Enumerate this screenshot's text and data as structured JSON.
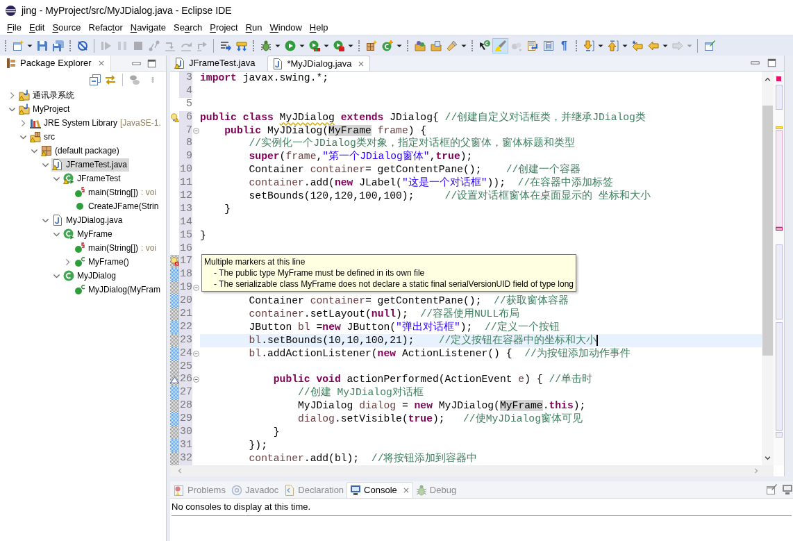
{
  "window": {
    "title": "jing - MyProject/src/MyJDialog.java - Eclipse IDE"
  },
  "menu": [
    {
      "key": "F",
      "after": "ile"
    },
    {
      "key": "E",
      "after": "dit"
    },
    {
      "key": "S",
      "after": "ource"
    },
    {
      "before": "Refac",
      "key": "t",
      "after": "or"
    },
    {
      "key": "N",
      "after": "avigate"
    },
    {
      "before": "Se",
      "key": "a",
      "after": "rch"
    },
    {
      "key": "P",
      "after": "roject"
    },
    {
      "key": "R",
      "after": "un"
    },
    {
      "key": "W",
      "after": "indow"
    },
    {
      "key": "H",
      "after": "elp"
    }
  ],
  "toolbar": [
    {
      "kind": "grip"
    },
    {
      "kind": "new-wizard",
      "disabled": false,
      "pressed": false,
      "menu": true
    },
    {
      "kind": "save",
      "disabled": false,
      "pressed": false,
      "menu": false
    },
    {
      "kind": "save-all",
      "disabled": false,
      "pressed": false,
      "menu": false
    },
    {
      "kind": "grip"
    },
    {
      "kind": "skip-breakpoints",
      "disabled": false,
      "pressed": false,
      "menu": false
    },
    {
      "kind": "separator"
    },
    {
      "kind": "resume",
      "disabled": true,
      "pressed": false,
      "menu": false
    },
    {
      "kind": "suspend",
      "disabled": true,
      "pressed": false,
      "menu": false
    },
    {
      "kind": "terminate",
      "disabled": true,
      "pressed": false,
      "menu": false
    },
    {
      "kind": "disconnect",
      "disabled": true,
      "pressed": false,
      "menu": false
    },
    {
      "kind": "step-into",
      "disabled": true,
      "pressed": false,
      "menu": false
    },
    {
      "kind": "step-over",
      "disabled": true,
      "pressed": false,
      "menu": false
    },
    {
      "kind": "step-return",
      "disabled": true,
      "pressed": false,
      "menu": false
    },
    {
      "kind": "separator"
    },
    {
      "kind": "step-filters",
      "disabled": false,
      "pressed": false,
      "menu": false
    },
    {
      "kind": "fork-arrows",
      "disabled": false,
      "pressed": false,
      "menu": false
    },
    {
      "kind": "grip"
    },
    {
      "kind": "debug",
      "disabled": false,
      "pressed": false,
      "menu": true
    },
    {
      "kind": "run",
      "disabled": false,
      "pressed": false,
      "menu": true
    },
    {
      "kind": "coverage",
      "disabled": false,
      "pressed": false,
      "menu": true
    },
    {
      "kind": "external-tools",
      "disabled": false,
      "pressed": false,
      "menu": true
    },
    {
      "kind": "grip"
    },
    {
      "kind": "new-package",
      "disabled": false,
      "pressed": false,
      "menu": false
    },
    {
      "kind": "new-class",
      "disabled": false,
      "pressed": false,
      "menu": true
    },
    {
      "kind": "grip"
    },
    {
      "kind": "open-type",
      "disabled": false,
      "pressed": false,
      "menu": false
    },
    {
      "kind": "open-task",
      "disabled": false,
      "pressed": false,
      "menu": false
    },
    {
      "kind": "search",
      "disabled": false,
      "pressed": false,
      "menu": true
    },
    {
      "kind": "grip"
    },
    {
      "kind": "breadcrumb",
      "disabled": false,
      "pressed": false,
      "menu": false
    },
    {
      "kind": "mark-occurrences",
      "disabled": false,
      "pressed": true,
      "menu": false
    },
    {
      "kind": "block-selection",
      "disabled": true,
      "pressed": false,
      "menu": false
    },
    {
      "kind": "word-wrap",
      "disabled": false,
      "pressed": false,
      "menu": false
    },
    {
      "kind": "framed-lines",
      "disabled": false,
      "pressed": false,
      "menu": false
    },
    {
      "kind": "whitespace",
      "glyph": "¶",
      "disabled": false,
      "pressed": false,
      "menu": false
    },
    {
      "kind": "grip"
    },
    {
      "kind": "next-annotation",
      "disabled": false,
      "pressed": false,
      "menu": true
    },
    {
      "kind": "prev-annotation",
      "disabled": false,
      "pressed": false,
      "menu": true
    },
    {
      "kind": "last-edit",
      "disabled": false,
      "pressed": false,
      "menu": false
    },
    {
      "kind": "back",
      "disabled": false,
      "pressed": false,
      "menu": true
    },
    {
      "kind": "forward",
      "disabled": true,
      "pressed": false,
      "menu": true
    },
    {
      "kind": "separator"
    },
    {
      "kind": "open-perspective",
      "disabled": false,
      "pressed": false,
      "menu": false
    }
  ],
  "package_explorer": {
    "title": "Package Explorer",
    "tree": [
      {
        "label": "通讯录系统",
        "kind": "project",
        "warning": true,
        "expanded": false,
        "selected": false
      },
      {
        "label": "MyProject",
        "kind": "project",
        "warning": true,
        "expanded": true,
        "selected": false,
        "children": [
          {
            "label": "JRE System Library",
            "detail": "[JavaSE-1.",
            "kind": "library",
            "warning": false,
            "expanded": false,
            "selected": false
          },
          {
            "label": "src",
            "kind": "source-folder",
            "warning": true,
            "expanded": true,
            "selected": false,
            "children": [
              {
                "label": "(default package)",
                "kind": "package",
                "warning": true,
                "expanded": true,
                "selected": false,
                "children": [
                  {
                    "label": "JFrameTest.java",
                    "kind": "java-file",
                    "warning": true,
                    "expanded": true,
                    "selected": true,
                    "children": [
                      {
                        "label": "JFrameTest",
                        "kind": "runnable-class",
                        "warning": true,
                        "expanded": true,
                        "selected": false,
                        "children": [
                          {
                            "label": "main(String[])",
                            "detail": ": voi",
                            "kind": "static-method",
                            "warning": false,
                            "selected": false
                          },
                          {
                            "label": "CreateJFame(Strin",
                            "kind": "method",
                            "warning": false,
                            "selected": false
                          }
                        ]
                      }
                    ]
                  },
                  {
                    "label": "MyJDialog.java",
                    "kind": "java-file",
                    "warning": false,
                    "expanded": true,
                    "selected": false,
                    "children": [
                      {
                        "label": "MyFrame",
                        "kind": "runnable-class",
                        "warning": false,
                        "expanded": true,
                        "selected": false,
                        "children": [
                          {
                            "label": "main(String[])",
                            "detail": ": voi",
                            "kind": "static-method",
                            "warning": false,
                            "selected": false
                          },
                          {
                            "label": "MyFrame()",
                            "kind": "constructor",
                            "warning": false,
                            "expanded": false,
                            "selected": false
                          }
                        ]
                      },
                      {
                        "label": "MyJDialog",
                        "kind": "class",
                        "warning": false,
                        "expanded": true,
                        "selected": false,
                        "children": [
                          {
                            "label": "MyJDialog(MyFram",
                            "kind": "constructor",
                            "warning": false,
                            "selected": false
                          }
                        ]
                      }
                    ]
                  }
                ]
              }
            ]
          }
        ]
      }
    ]
  },
  "editor": {
    "tabs": [
      {
        "label": "JFrameTest.java",
        "warning": true,
        "selected": false
      },
      {
        "label": "*MyJDialog.java",
        "warning": false,
        "selected": true
      }
    ],
    "lines": [
      {
        "number": "3",
        "change": true,
        "range": false,
        "current": false,
        "tokens": [
          {
            "kind": "kw",
            "text": "import"
          },
          {
            "kind": "txt",
            "text": " javax.swing.*;"
          }
        ]
      },
      {
        "number": "4",
        "change": true,
        "range": false,
        "current": false
      },
      {
        "number": "5",
        "change": false,
        "range": false,
        "current": false
      },
      {
        "number": "6",
        "change": true,
        "range": false,
        "current": false,
        "marker": {
          "kind": "warning"
        },
        "tokens": [
          {
            "kind": "kw",
            "text": "public class "
          },
          {
            "kind": "warn",
            "text": "MyJDialog"
          },
          {
            "kind": "kw",
            "text": " extends"
          },
          {
            "kind": "txt",
            "text": " JDialog{ "
          },
          {
            "kind": "com",
            "text": "//创建自定义对话框类，并继承JDialog类"
          }
        ]
      },
      {
        "number": "7",
        "change": true,
        "range": false,
        "current": false,
        "fold": {
          "expanded": true
        },
        "tokens": [
          {
            "kind": "kw",
            "text": "    public"
          },
          {
            "kind": "txt",
            "text": " MyJDialog("
          },
          {
            "kind": "occ",
            "text": "MyFrame"
          },
          {
            "kind": "var",
            "text": " frame"
          },
          {
            "kind": "txt",
            "text": ") {"
          }
        ]
      },
      {
        "number": "8",
        "change": true,
        "range": false,
        "current": false,
        "tokens": [
          {
            "kind": "com",
            "text": "        //实例化一个JDialog类对象，指定对话框的父窗体，窗体标题和类型"
          }
        ]
      },
      {
        "number": "9",
        "change": true,
        "range": false,
        "current": false,
        "tokens": [
          {
            "kind": "kw",
            "text": "        super"
          },
          {
            "kind": "txt",
            "text": "("
          },
          {
            "kind": "var",
            "text": "frame"
          },
          {
            "kind": "txt",
            "text": ","
          },
          {
            "kind": "str",
            "text": "\"第一个JDialog窗体\""
          },
          {
            "kind": "txt",
            "text": ","
          },
          {
            "kind": "kw",
            "text": "true"
          },
          {
            "kind": "txt",
            "text": ");"
          }
        ]
      },
      {
        "number": "10",
        "change": true,
        "range": false,
        "current": false,
        "tokens": [
          {
            "kind": "txt",
            "text": "        Container "
          },
          {
            "kind": "var",
            "text": "container"
          },
          {
            "kind": "txt",
            "text": "= getContentPane();    "
          },
          {
            "kind": "com",
            "text": "//创建一个容器"
          }
        ]
      },
      {
        "number": "11",
        "change": true,
        "range": false,
        "current": false,
        "tokens": [
          {
            "kind": "var",
            "text": "        container"
          },
          {
            "kind": "txt",
            "text": ".add("
          },
          {
            "kind": "kw",
            "text": "new"
          },
          {
            "kind": "txt",
            "text": " JLabel("
          },
          {
            "kind": "str",
            "text": "\"这是一个对话框\""
          },
          {
            "kind": "txt",
            "text": "));  "
          },
          {
            "kind": "com",
            "text": "//在容器中添加标签"
          }
        ]
      },
      {
        "number": "12",
        "change": true,
        "range": false,
        "current": false,
        "tokens": [
          {
            "kind": "txt",
            "text": "        setBounds(120,120,100,100);     "
          },
          {
            "kind": "com",
            "text": "//设置对话框窗体在桌面显示的 坐标和大小"
          }
        ]
      },
      {
        "number": "13",
        "change": true,
        "range": false,
        "current": false,
        "tokens": [
          {
            "kind": "txt",
            "text": "    }"
          }
        ]
      },
      {
        "number": "14",
        "change": true,
        "range": false,
        "current": false
      },
      {
        "number": "15",
        "change": true,
        "range": false,
        "current": false,
        "tokens": [
          {
            "kind": "txt",
            "text": "}"
          }
        ]
      },
      {
        "number": "16",
        "change": true,
        "range": false,
        "current": false
      },
      {
        "number": "17",
        "change": true,
        "range": true,
        "current": false,
        "marker": {
          "kind": "error"
        }
      },
      {
        "number": "18",
        "change": true,
        "range": true,
        "current": false
      },
      {
        "number": "19",
        "change": true,
        "range": true,
        "current": false,
        "fold": {
          "expanded": true
        }
      },
      {
        "number": "20",
        "change": true,
        "range": true,
        "current": false,
        "tokens": [
          {
            "kind": "txt",
            "text": "        Container "
          },
          {
            "kind": "var",
            "text": "container"
          },
          {
            "kind": "txt",
            "text": "= getContentPane();  "
          },
          {
            "kind": "com",
            "text": "//获取窗体容器"
          }
        ]
      },
      {
        "number": "21",
        "change": true,
        "range": true,
        "current": false,
        "tokens": [
          {
            "kind": "var",
            "text": "        container"
          },
          {
            "kind": "txt",
            "text": ".setLayout("
          },
          {
            "kind": "kw",
            "text": "null"
          },
          {
            "kind": "txt",
            "text": ");  "
          },
          {
            "kind": "com",
            "text": "//容器使用NULL布局"
          }
        ]
      },
      {
        "number": "22",
        "change": true,
        "range": true,
        "current": false,
        "tokens": [
          {
            "kind": "txt",
            "text": "        JButton "
          },
          {
            "kind": "var",
            "text": "bl"
          },
          {
            "kind": "txt",
            "text": " ="
          },
          {
            "kind": "kw",
            "text": "new"
          },
          {
            "kind": "txt",
            "text": " JButton("
          },
          {
            "kind": "str",
            "text": "\"弹出对话框\""
          },
          {
            "kind": "txt",
            "text": ");  "
          },
          {
            "kind": "com",
            "text": "//定义一个按钮"
          }
        ]
      },
      {
        "number": "23",
        "change": true,
        "range": true,
        "current": true,
        "tokens": [
          {
            "kind": "var",
            "text": "        bl"
          },
          {
            "kind": "txt",
            "text": ".setBounds(10,10,100,21);    "
          },
          {
            "kind": "com",
            "text": "//定义按钮在容器中的坐标和大小"
          }
        ]
      },
      {
        "number": "24",
        "change": true,
        "range": true,
        "current": false,
        "fold": {
          "expanded": true
        },
        "tokens": [
          {
            "kind": "var",
            "text": "        bl"
          },
          {
            "kind": "txt",
            "text": ".addActionListener("
          },
          {
            "kind": "kw",
            "text": "new"
          },
          {
            "kind": "txt",
            "text": " ActionListener() {  "
          },
          {
            "kind": "com",
            "text": "//为按钮添加动作事件"
          }
        ]
      },
      {
        "number": "25",
        "change": true,
        "range": true,
        "current": false
      },
      {
        "number": "26",
        "change": true,
        "range": true,
        "current": false,
        "marker": {
          "kind": "override"
        },
        "fold": {
          "expanded": true
        },
        "tokens": [
          {
            "kind": "kw",
            "text": "            public void"
          },
          {
            "kind": "txt",
            "text": " actionPerformed(ActionEvent "
          },
          {
            "kind": "var",
            "text": "e"
          },
          {
            "kind": "txt",
            "text": ") { "
          },
          {
            "kind": "com",
            "text": "//单击时"
          }
        ]
      },
      {
        "number": "27",
        "change": true,
        "range": true,
        "current": false,
        "tokens": [
          {
            "kind": "com",
            "text": "                //创建 MyJDialog对话框"
          }
        ]
      },
      {
        "number": "28",
        "change": true,
        "range": true,
        "current": false,
        "tokens": [
          {
            "kind": "txt",
            "text": "                MyJDialog "
          },
          {
            "kind": "var",
            "text": "dialog"
          },
          {
            "kind": "txt",
            "text": " = "
          },
          {
            "kind": "kw",
            "text": "new"
          },
          {
            "kind": "txt",
            "text": " MyJDialog("
          },
          {
            "kind": "occ",
            "text": "MyFrame"
          },
          {
            "kind": "txt",
            "text": "."
          },
          {
            "kind": "kw",
            "text": "this"
          },
          {
            "kind": "txt",
            "text": ");"
          }
        ]
      },
      {
        "number": "29",
        "change": true,
        "range": true,
        "current": false,
        "tokens": [
          {
            "kind": "var",
            "text": "                dialog"
          },
          {
            "kind": "txt",
            "text": ".setVisible("
          },
          {
            "kind": "kw",
            "text": "true"
          },
          {
            "kind": "txt",
            "text": ");   "
          },
          {
            "kind": "com",
            "text": "//使MyJDialog窗体可见"
          }
        ]
      },
      {
        "number": "30",
        "change": true,
        "range": true,
        "current": false,
        "tokens": [
          {
            "kind": "txt",
            "text": "            }"
          }
        ]
      },
      {
        "number": "31",
        "change": true,
        "range": true,
        "current": false,
        "tokens": [
          {
            "kind": "txt",
            "text": "        });"
          }
        ]
      },
      {
        "number": "32",
        "change": true,
        "range": true,
        "current": false,
        "tokens": [
          {
            "kind": "var",
            "text": "        container"
          },
          {
            "kind": "txt",
            "text": ".add(bl);  "
          },
          {
            "kind": "com",
            "text": "//将按钮添加到容器中"
          }
        ]
      }
    ],
    "hover": {
      "title": "Multiple markers at this line",
      "items": [
        "- The public type MyFrame must be defined in its own file",
        "- The serializable class MyFrame does not declare a static final serialVersionUID field of type long"
      ]
    }
  },
  "bottom_panel": {
    "tabs": [
      {
        "label": "Problems",
        "kind": "problems",
        "selected": false
      },
      {
        "label": "Javadoc",
        "kind": "javadoc",
        "selected": false
      },
      {
        "label": "Declaration",
        "kind": "declaration",
        "selected": false
      },
      {
        "label": "Console",
        "kind": "console",
        "selected": true
      },
      {
        "label": "Debug",
        "kind": "debug",
        "selected": false
      }
    ],
    "message": "No consoles to display at this time."
  }
}
